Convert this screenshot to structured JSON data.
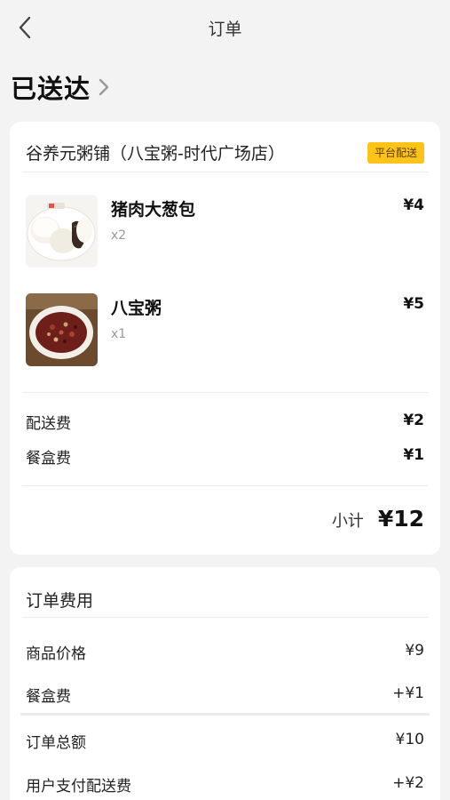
{
  "header": {
    "title": "订单"
  },
  "status": {
    "label": "已送达"
  },
  "store": {
    "name": "谷养元粥铺（八宝粥-时代广场店）",
    "delivery_badge": "平台配送"
  },
  "items": [
    {
      "name": "猪肉大葱包",
      "qty": "x2",
      "price": "¥4",
      "image": "steamed-buns"
    },
    {
      "name": "八宝粥",
      "qty": "x1",
      "price": "¥5",
      "image": "eight-treasure-congee"
    }
  ],
  "fees": [
    {
      "label": "配送费",
      "value": "¥2"
    },
    {
      "label": "餐盒费",
      "value": "¥1"
    }
  ],
  "subtotal": {
    "label": "小计",
    "value": "¥12"
  },
  "order_costs": {
    "title": "订单费用",
    "rows": [
      {
        "label": "商品价格",
        "value": "¥9"
      },
      {
        "label": "餐盒费",
        "value": "+¥1"
      },
      {
        "label": "订单总额",
        "value": "¥10"
      },
      {
        "label": "用户支付配送费",
        "value": "+¥2"
      }
    ]
  },
  "colors": {
    "badge": "#fcc419",
    "background": "#f3f3f3"
  }
}
